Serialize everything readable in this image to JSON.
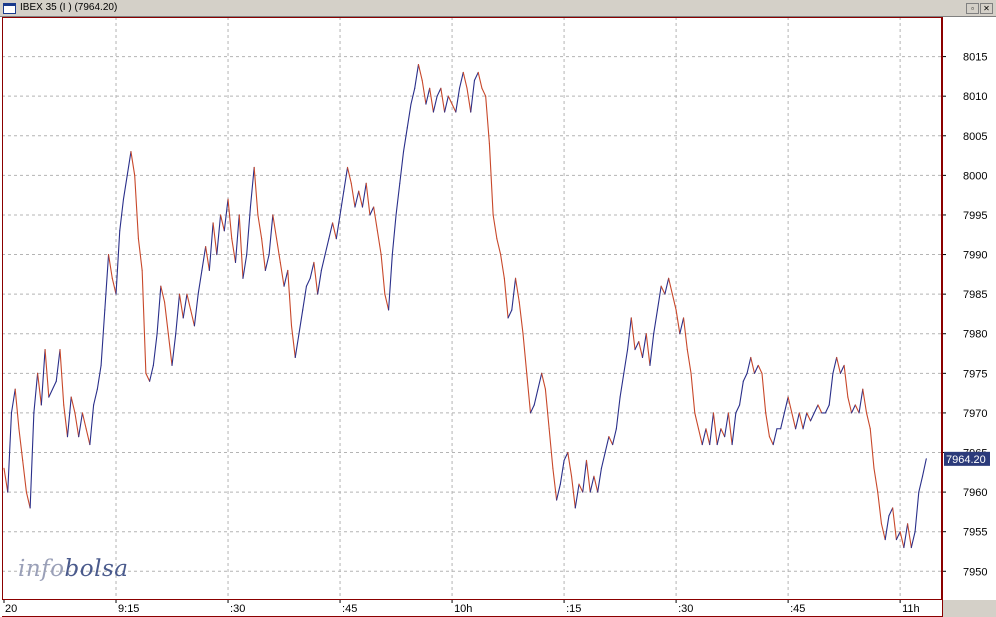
{
  "window": {
    "title": "IBEX 35 (I ) (7964.20)",
    "restore_glyph": "▫",
    "close_glyph": "✕"
  },
  "watermark": {
    "part1": "info",
    "part2": "bolsa"
  },
  "colors": {
    "up": "#2a2f8a",
    "down": "#c8482a",
    "frame": "#8b0000",
    "grid": "#b4b4b4",
    "price_tag_bg": "#2b3a7a"
  },
  "chart_data": {
    "type": "line",
    "title": "IBEX 35 (I ) (7964.20)",
    "xlabel": "",
    "ylabel": "",
    "ylim": [
      7946.5,
      8020
    ],
    "y_ticks": [
      7950,
      7955,
      7960,
      7965,
      7970,
      7975,
      7980,
      7985,
      7990,
      7995,
      8000,
      8005,
      8010,
      8015
    ],
    "x_ticks": [
      {
        "t": 0,
        "label": "20"
      },
      {
        "t": 15,
        "label": "9:15"
      },
      {
        "t": 30,
        "label": ":30"
      },
      {
        "t": 45,
        "label": ":45"
      },
      {
        "t": 60,
        "label": "10h"
      },
      {
        "t": 75,
        "label": ":15"
      },
      {
        "t": 90,
        "label": ":30"
      },
      {
        "t": 105,
        "label": ":45"
      },
      {
        "t": 120,
        "label": "11h"
      }
    ],
    "xlim": [
      0,
      128
    ],
    "last_price": "7964.20",
    "grid": true,
    "series": [
      {
        "values": [
          [
            0,
            7963
          ],
          [
            0.5,
            7960
          ],
          [
            1,
            7970
          ],
          [
            1.5,
            7973
          ],
          [
            2,
            7968
          ],
          [
            2.5,
            7964
          ],
          [
            3,
            7960
          ],
          [
            3.5,
            7958
          ],
          [
            4,
            7970
          ],
          [
            4.5,
            7975
          ],
          [
            5,
            7971
          ],
          [
            5.5,
            7978
          ],
          [
            6,
            7972
          ],
          [
            7,
            7974
          ],
          [
            7.5,
            7978
          ],
          [
            8,
            7971
          ],
          [
            8.5,
            7967
          ],
          [
            9,
            7972
          ],
          [
            9.5,
            7970
          ],
          [
            10,
            7967
          ],
          [
            10.5,
            7970
          ],
          [
            11,
            7968
          ],
          [
            11.5,
            7966
          ],
          [
            12,
            7971
          ],
          [
            12.5,
            7973
          ],
          [
            13,
            7976
          ],
          [
            13.5,
            7983
          ],
          [
            14,
            7990
          ],
          [
            14.5,
            7987
          ],
          [
            15,
            7985
          ],
          [
            15.5,
            7993
          ],
          [
            16,
            7997
          ],
          [
            16.5,
            8000
          ],
          [
            17,
            8003
          ],
          [
            17.5,
            8000
          ],
          [
            18,
            7992
          ],
          [
            18.5,
            7988
          ],
          [
            19,
            7975
          ],
          [
            19.5,
            7974
          ],
          [
            20,
            7976
          ],
          [
            20.5,
            7980
          ],
          [
            21,
            7986
          ],
          [
            21.5,
            7984
          ],
          [
            22,
            7980
          ],
          [
            22.5,
            7976
          ],
          [
            23,
            7980
          ],
          [
            23.5,
            7985
          ],
          [
            24,
            7982
          ],
          [
            24.5,
            7985
          ],
          [
            25,
            7983
          ],
          [
            25.5,
            7981
          ],
          [
            26,
            7985
          ],
          [
            26.5,
            7988
          ],
          [
            27,
            7991
          ],
          [
            27.5,
            7988
          ],
          [
            28,
            7994
          ],
          [
            28.5,
            7990
          ],
          [
            29,
            7995
          ],
          [
            29.5,
            7993
          ],
          [
            30,
            7997
          ],
          [
            30.5,
            7992
          ],
          [
            31,
            7989
          ],
          [
            31.5,
            7995
          ],
          [
            32,
            7987
          ],
          [
            32.5,
            7990
          ],
          [
            33,
            7996
          ],
          [
            33.5,
            8001
          ],
          [
            34,
            7995
          ],
          [
            34.5,
            7992
          ],
          [
            35,
            7988
          ],
          [
            35.5,
            7990
          ],
          [
            36,
            7995
          ],
          [
            36.5,
            7992
          ],
          [
            37,
            7989
          ],
          [
            37.5,
            7986
          ],
          [
            38,
            7988
          ],
          [
            38.5,
            7981
          ],
          [
            39,
            7977
          ],
          [
            39.5,
            7980
          ],
          [
            40,
            7983
          ],
          [
            40.5,
            7986
          ],
          [
            41,
            7987
          ],
          [
            41.5,
            7989
          ],
          [
            42,
            7985
          ],
          [
            42.5,
            7988
          ],
          [
            43,
            7990
          ],
          [
            43.5,
            7992
          ],
          [
            44,
            7994
          ],
          [
            44.5,
            7992
          ],
          [
            45,
            7995
          ],
          [
            45.5,
            7998
          ],
          [
            46,
            8001
          ],
          [
            46.5,
            7999
          ],
          [
            47,
            7996
          ],
          [
            47.5,
            7998
          ],
          [
            48,
            7996
          ],
          [
            48.5,
            7999
          ],
          [
            49,
            7995
          ],
          [
            49.5,
            7996
          ],
          [
            50,
            7993
          ],
          [
            50.5,
            7990
          ],
          [
            51,
            7985
          ],
          [
            51.5,
            7983
          ],
          [
            52,
            7990
          ],
          [
            52.5,
            7995
          ],
          [
            53,
            7999
          ],
          [
            53.5,
            8003
          ],
          [
            54,
            8006
          ],
          [
            54.5,
            8009
          ],
          [
            55,
            8011
          ],
          [
            55.5,
            8014
          ],
          [
            56,
            8012
          ],
          [
            56.5,
            8009
          ],
          [
            57,
            8011
          ],
          [
            57.5,
            8008
          ],
          [
            58,
            8010
          ],
          [
            58.5,
            8011
          ],
          [
            59,
            8008
          ],
          [
            59.5,
            8010
          ],
          [
            60,
            8009
          ],
          [
            60.5,
            8008
          ],
          [
            61,
            8011
          ],
          [
            61.5,
            8013
          ],
          [
            62,
            8011
          ],
          [
            62.5,
            8008
          ],
          [
            63,
            8012
          ],
          [
            63.5,
            8013
          ],
          [
            64,
            8011
          ],
          [
            64.5,
            8010
          ],
          [
            65,
            8004
          ],
          [
            65.5,
            7995
          ],
          [
            66,
            7992
          ],
          [
            66.5,
            7990
          ],
          [
            67,
            7987
          ],
          [
            67.5,
            7982
          ],
          [
            68,
            7983
          ],
          [
            68.5,
            7987
          ],
          [
            69,
            7984
          ],
          [
            69.5,
            7980
          ],
          [
            70,
            7975
          ],
          [
            70.5,
            7970
          ],
          [
            71,
            7971
          ],
          [
            71.5,
            7973
          ],
          [
            72,
            7975
          ],
          [
            72.5,
            7973
          ],
          [
            73,
            7968
          ],
          [
            73.5,
            7963
          ],
          [
            74,
            7959
          ],
          [
            74.5,
            7961
          ],
          [
            75,
            7964
          ],
          [
            75.5,
            7965
          ],
          [
            76,
            7962
          ],
          [
            76.5,
            7958
          ],
          [
            77,
            7961
          ],
          [
            77.5,
            7960
          ],
          [
            78,
            7964
          ],
          [
            78.5,
            7960
          ],
          [
            79,
            7962
          ],
          [
            79.5,
            7960
          ],
          [
            80,
            7963
          ],
          [
            80.5,
            7965
          ],
          [
            81,
            7967
          ],
          [
            81.5,
            7966
          ],
          [
            82,
            7968
          ],
          [
            82.5,
            7972
          ],
          [
            83,
            7975
          ],
          [
            83.5,
            7978
          ],
          [
            84,
            7982
          ],
          [
            84.5,
            7978
          ],
          [
            85,
            7979
          ],
          [
            85.5,
            7977
          ],
          [
            86,
            7980
          ],
          [
            86.5,
            7976
          ],
          [
            87,
            7980
          ],
          [
            87.5,
            7983
          ],
          [
            88,
            7986
          ],
          [
            88.5,
            7985
          ],
          [
            89,
            7987
          ],
          [
            89.5,
            7985
          ],
          [
            90,
            7983
          ],
          [
            90.5,
            7980
          ],
          [
            91,
            7982
          ],
          [
            91.5,
            7978
          ],
          [
            92,
            7975
          ],
          [
            92.5,
            7970
          ],
          [
            93,
            7968
          ],
          [
            93.5,
            7966
          ],
          [
            94,
            7968
          ],
          [
            94.5,
            7966
          ],
          [
            95,
            7970
          ],
          [
            95.5,
            7966
          ],
          [
            96,
            7968
          ],
          [
            96.5,
            7967
          ],
          [
            97,
            7970
          ],
          [
            97.5,
            7966
          ],
          [
            98,
            7970
          ],
          [
            98.5,
            7971
          ],
          [
            99,
            7974
          ],
          [
            99.5,
            7975
          ],
          [
            100,
            7977
          ],
          [
            100.5,
            7975
          ],
          [
            101,
            7976
          ],
          [
            101.5,
            7975
          ],
          [
            102,
            7970
          ],
          [
            102.5,
            7967
          ],
          [
            103,
            7966
          ],
          [
            103.5,
            7968
          ],
          [
            104,
            7968
          ],
          [
            104.5,
            7970
          ],
          [
            105,
            7972
          ],
          [
            105.5,
            7970
          ],
          [
            106,
            7968
          ],
          [
            106.5,
            7970
          ],
          [
            107,
            7968
          ],
          [
            107.5,
            7970
          ],
          [
            108,
            7969
          ],
          [
            108.5,
            7970
          ],
          [
            109,
            7971
          ],
          [
            109.5,
            7970
          ],
          [
            110,
            7970
          ],
          [
            110.5,
            7971
          ],
          [
            111,
            7975
          ],
          [
            111.5,
            7977
          ],
          [
            112,
            7975
          ],
          [
            112.5,
            7976
          ],
          [
            113,
            7972
          ],
          [
            113.5,
            7970
          ],
          [
            114,
            7971
          ],
          [
            114.5,
            7970
          ],
          [
            115,
            7973
          ],
          [
            115.5,
            7970
          ],
          [
            116,
            7968
          ],
          [
            116.5,
            7963
          ],
          [
            117,
            7960
          ],
          [
            117.5,
            7956
          ],
          [
            118,
            7954
          ],
          [
            118.5,
            7957
          ],
          [
            119,
            7958
          ],
          [
            119.5,
            7954
          ],
          [
            120,
            7955
          ],
          [
            120.5,
            7953
          ],
          [
            121,
            7956
          ],
          [
            121.5,
            7953
          ],
          [
            122,
            7955
          ],
          [
            122.5,
            7960
          ],
          [
            123,
            7962
          ],
          [
            123.5,
            7964.2
          ]
        ]
      }
    ]
  }
}
